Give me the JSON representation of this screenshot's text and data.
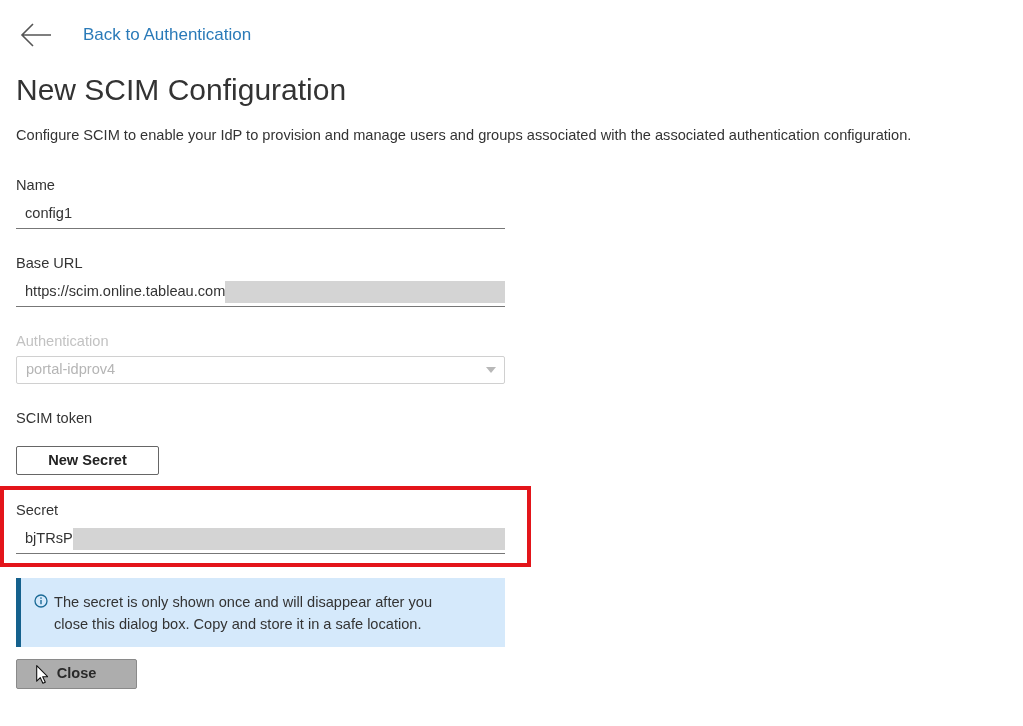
{
  "back_link": {
    "label": "Back to Authentication"
  },
  "title": "New SCIM Configuration",
  "description": "Configure SCIM to enable your IdP to provision and manage users and groups associated with the associated authentication configuration.",
  "fields": [
    {
      "kind": "text",
      "label": "Name",
      "value": "config1"
    },
    {
      "kind": "text",
      "label": "Base URL",
      "value": "https://scim.online.tableau.com",
      "redacted": true
    },
    {
      "kind": "select",
      "label": "Authentication",
      "value": "portal-idprov4",
      "disabled": true
    },
    {
      "kind": "button",
      "label": "SCIM token",
      "button": "New Secret"
    },
    {
      "kind": "text",
      "label": "Secret",
      "value": "bjTRsP",
      "redacted": true,
      "highlighted": true
    }
  ],
  "notice": {
    "text": "The secret is only shown once and will disappear after you close this dialog box. Copy and store it in a safe location."
  },
  "close_button": {
    "label": "Close",
    "hovered": true
  }
}
